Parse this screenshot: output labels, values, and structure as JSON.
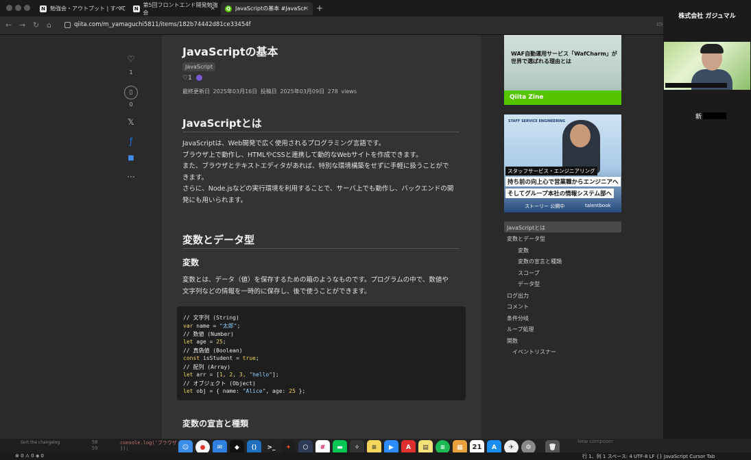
{
  "browser": {
    "tabs": [
      {
        "title": "勉強会・アウトプット | すべて",
        "icon": "notion-icon"
      },
      {
        "title": "第5回フロントエンド開発勉強会",
        "icon": "notion-icon"
      },
      {
        "title": "JavaScriptの基本 #JavaScript",
        "icon": "qiita-icon",
        "active": true
      }
    ],
    "url": "qiita.com/m_yamaguchi5811/items/182b74442d81ce33454f"
  },
  "article": {
    "title": "JavaScriptの基本",
    "tag": "JavaScript",
    "likes": "1",
    "meta": "最終更新日 2025年03月16日  投稿日 2025年03月09日  278 views",
    "side": {
      "like_count": "1",
      "stock_count": "0"
    },
    "h2_1": "JavaScriptとは",
    "para1": [
      "JavaScriptは、Web開発で広く使用されるプログラミング言語です。",
      "ブラウザ上で動作し、HTMLやCSSと連携して動的なWebサイトを作成できます。",
      "また、ブラウザとテキストエディタがあれば、特別な環境構築をせずに手軽に扱うことがで",
      "きます。",
      "さらに、Node.jsなどの実行環境を利用することで、サーバ上でも動作し、バックエンドの開",
      "発にも用いられます。"
    ],
    "h2_2": "変数とデータ型",
    "h3_1": "変数",
    "para2": [
      "変数とは、データ（値）を保存するための箱のようなものです。プログラムの中で、数値や",
      "文字列などの情報を一時的に保存し、後で使うことができます。"
    ],
    "code": {
      "c1": "// 文字列 (String)",
      "l1a": "var",
      "l1b": " name = ",
      "l1c": "\"太郎\"",
      "l1d": ";",
      "c2": "// 数値 (Number)",
      "l2a": "let",
      "l2b": " age = ",
      "l2c": "25",
      "l2d": ";",
      "c3": "// 真偽値 (Boolean)",
      "l3a": "const",
      "l3b": " isStudent = ",
      "l3c": "true",
      "l3d": ";",
      "c4": "// 配列 (Array)",
      "l4a": "let",
      "l4b": " arr = [",
      "l4c": "1, 2, 3, ",
      "l4e": "\"hello\"",
      "l4d": "];",
      "c5": "// オブジェクト (Object)",
      "l5a": "let",
      "l5b": " obj = { name: ",
      "l5c": "\"Alice\"",
      "l5e": ", age: ",
      "l5f": "25",
      "l5d": " };"
    },
    "h3_2": "変数の宣言と種類"
  },
  "ads": {
    "ad1_text": "WAF自動運用サービス「WafCharm」が世界で選ばれる理由とは",
    "ad1_band": "Qiita Zine",
    "ad2_logo": "STAFF SERVICE ENGINEERING",
    "ad2_b1": "スタッフサービス・エンジニアリング",
    "ad2_b2": "持ち前の向上心で営業職からエンジニアへ",
    "ad2_b3": "そしてグループ本社の情報システム部へ",
    "ad2_story": "ストーリー 公開中",
    "ad2_brand": "talentbook"
  },
  "toc": [
    {
      "label": "JavaScriptとは",
      "level": 1,
      "active": true
    },
    {
      "label": "変数とデータ型",
      "level": 1
    },
    {
      "label": "変数",
      "level": 2
    },
    {
      "label": "変数の宣言と種類",
      "level": 2
    },
    {
      "label": "スコープ",
      "level": 2
    },
    {
      "label": "データ型",
      "level": 2
    },
    {
      "label": "ログ出力",
      "level": 1
    },
    {
      "label": "コメント",
      "level": 1
    },
    {
      "label": "条件分岐",
      "level": 1
    },
    {
      "label": "ループ処理",
      "level": 1
    },
    {
      "label": "関数",
      "level": 1
    },
    {
      "label": "イベントリスナー",
      "level": 1
    }
  ],
  "meeting": {
    "company": "株式会社 ガジュマル",
    "name": "新"
  },
  "editor": {
    "line58": "58",
    "line59": "59",
    "code58": "console.log('ブラウザ",
    "code59": "});",
    "hint": "Sort the changelog",
    "compose": "New composer",
    "status_left": "⊗ 0 ⚠ 0   ◈ 0",
    "status_right": "行 1、列 1   スペース: 4   UTF-8   LF   {} JavaScript   Cursor Tab"
  },
  "dock": {
    "calendar_day": "21"
  }
}
